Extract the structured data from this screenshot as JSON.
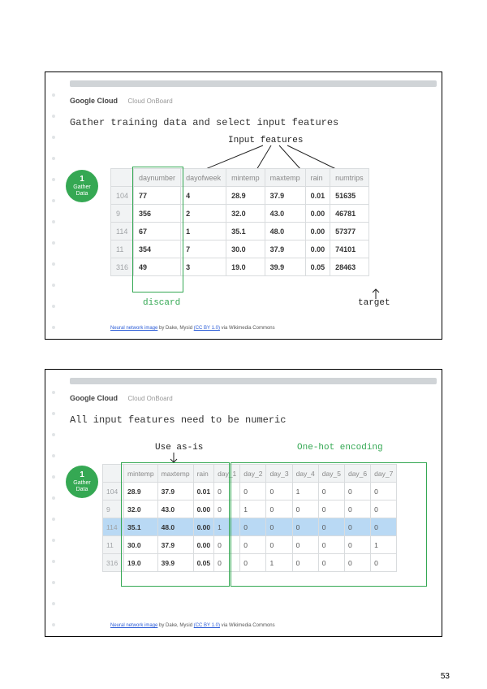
{
  "page_number": "53",
  "brand": {
    "name": "Google Cloud",
    "product": "Cloud OnBoard"
  },
  "credit": {
    "prefix": "Neural network image",
    "by": " by Dake, Mysid ",
    "licence": "(CC BY 1.0)",
    "via": " via Wikimedia Commons"
  },
  "step_badge": {
    "num": "1",
    "label": "Gather\nData"
  },
  "slide1": {
    "title": "Gather training data and select input features",
    "labels": {
      "input_features": "Input features",
      "discard": "discard",
      "target": "target"
    },
    "table": {
      "headers": [
        "",
        "daynumber",
        "dayofweek",
        "mintemp",
        "maxtemp",
        "rain",
        "numtrips"
      ],
      "rows": [
        {
          "idx": "104",
          "cells": [
            "77",
            "4",
            "28.9",
            "37.9",
            "0.01",
            "51635"
          ]
        },
        {
          "idx": "9",
          "cells": [
            "356",
            "2",
            "32.0",
            "43.0",
            "0.00",
            "46781"
          ]
        },
        {
          "idx": "114",
          "cells": [
            "67",
            "1",
            "35.1",
            "48.0",
            "0.00",
            "57377"
          ]
        },
        {
          "idx": "11",
          "cells": [
            "354",
            "7",
            "30.0",
            "37.9",
            "0.00",
            "74101"
          ]
        },
        {
          "idx": "316",
          "cells": [
            "49",
            "3",
            "19.0",
            "39.9",
            "0.05",
            "28463"
          ]
        }
      ]
    }
  },
  "slide2": {
    "title": "All input features need to be numeric",
    "labels": {
      "use_as_is": "Use as-is",
      "one_hot": "One-hot encoding"
    },
    "table": {
      "headers": [
        "",
        "mintemp",
        "maxtemp",
        "rain",
        "day_1",
        "day_2",
        "day_3",
        "day_4",
        "day_5",
        "day_6",
        "day_7"
      ],
      "rows": [
        {
          "idx": "104",
          "hl": false,
          "cells": [
            "28.9",
            "37.9",
            "0.01",
            "0",
            "0",
            "0",
            "1",
            "0",
            "0",
            "0"
          ]
        },
        {
          "idx": "9",
          "hl": false,
          "cells": [
            "32.0",
            "43.0",
            "0.00",
            "0",
            "1",
            "0",
            "0",
            "0",
            "0",
            "0"
          ]
        },
        {
          "idx": "114",
          "hl": true,
          "cells": [
            "35.1",
            "48.0",
            "0.00",
            "1",
            "0",
            "0",
            "0",
            "0",
            "0",
            "0"
          ]
        },
        {
          "idx": "11",
          "hl": false,
          "cells": [
            "30.0",
            "37.9",
            "0.00",
            "0",
            "0",
            "0",
            "0",
            "0",
            "0",
            "1"
          ]
        },
        {
          "idx": "316",
          "hl": false,
          "cells": [
            "19.0",
            "39.9",
            "0.05",
            "0",
            "0",
            "1",
            "0",
            "0",
            "0",
            "0"
          ]
        }
      ]
    }
  },
  "chart_data": [
    {
      "type": "table",
      "title": "Gather training data and select input features",
      "columns": [
        "daynumber",
        "dayofweek",
        "mintemp",
        "maxtemp",
        "rain",
        "numtrips"
      ],
      "index": [
        104,
        9,
        114,
        11,
        316
      ],
      "rows": [
        [
          77,
          4,
          28.9,
          37.9,
          0.01,
          51635
        ],
        [
          356,
          2,
          32.0,
          43.0,
          0.0,
          46781
        ],
        [
          67,
          1,
          35.1,
          48.0,
          0.0,
          57377
        ],
        [
          354,
          7,
          30.0,
          37.9,
          0.0,
          74101
        ],
        [
          49,
          3,
          19.0,
          39.9,
          0.05,
          28463
        ]
      ],
      "annotations": {
        "discard": "daynumber",
        "target": "numtrips",
        "input_features": [
          "dayofweek",
          "mintemp",
          "maxtemp",
          "rain"
        ]
      }
    },
    {
      "type": "table",
      "title": "All input features need to be numeric",
      "columns": [
        "mintemp",
        "maxtemp",
        "rain",
        "day_1",
        "day_2",
        "day_3",
        "day_4",
        "day_5",
        "day_6",
        "day_7"
      ],
      "index": [
        104,
        9,
        114,
        11,
        316
      ],
      "rows": [
        [
          28.9,
          37.9,
          0.01,
          0,
          0,
          0,
          1,
          0,
          0,
          0
        ],
        [
          32.0,
          43.0,
          0.0,
          0,
          1,
          0,
          0,
          0,
          0,
          0
        ],
        [
          35.1,
          48.0,
          0.0,
          1,
          0,
          0,
          0,
          0,
          0,
          0
        ],
        [
          30.0,
          37.9,
          0.0,
          0,
          0,
          0,
          0,
          0,
          0,
          1
        ],
        [
          19.0,
          39.9,
          0.05,
          0,
          0,
          1,
          0,
          0,
          0,
          0
        ]
      ],
      "annotations": {
        "use_as_is": [
          "mintemp",
          "maxtemp",
          "rain"
        ],
        "one_hot_encoding": [
          "day_1",
          "day_2",
          "day_3",
          "day_4",
          "day_5",
          "day_6",
          "day_7"
        ],
        "highlighted_row_index": 114
      }
    }
  ]
}
